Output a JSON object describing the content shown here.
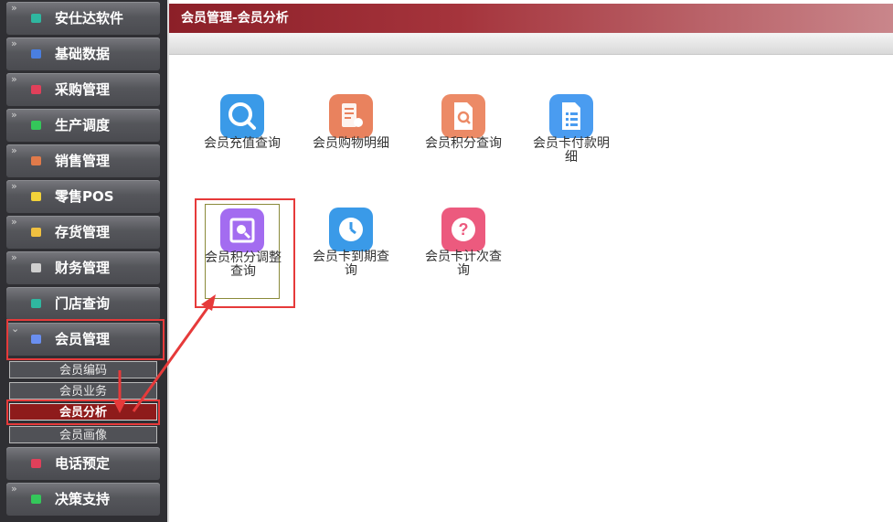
{
  "sidebar": {
    "items": [
      {
        "label": "安仕达软件",
        "icon": "app-icon",
        "color": "#2fb7a0"
      },
      {
        "label": "基础数据",
        "icon": "data-icon",
        "color": "#4a7fe0"
      },
      {
        "label": "采购管理",
        "icon": "purchase-icon",
        "color": "#e0405a"
      },
      {
        "label": "生产调度",
        "icon": "production-icon",
        "color": "#34c75a"
      },
      {
        "label": "销售管理",
        "icon": "sales-icon",
        "color": "#e07a4a"
      },
      {
        "label": "零售POS",
        "icon": "pos-icon",
        "color": "#f2d23a"
      },
      {
        "label": "存货管理",
        "icon": "inventory-icon",
        "color": "#f0c040"
      },
      {
        "label": "财务管理",
        "icon": "finance-icon",
        "color": "#cfcfcf"
      },
      {
        "label": "门店查询",
        "icon": "store-icon",
        "color": "#2fb7a0"
      },
      {
        "label": "会员管理",
        "icon": "member-icon",
        "color": "#6a8ff0"
      },
      {
        "label": "电话预定",
        "icon": "phone-icon",
        "color": "#e0405a"
      },
      {
        "label": "决策支持",
        "icon": "decision-icon",
        "color": "#34c75a"
      }
    ],
    "subitems": [
      {
        "label": "会员编码"
      },
      {
        "label": "会员业务"
      },
      {
        "label": "会员分析"
      },
      {
        "label": "会员画像"
      }
    ]
  },
  "header": {
    "title": "会员管理-会员分析"
  },
  "tiles": [
    {
      "label": "会员充值查询",
      "icon": "search-icon",
      "color": "#3a9ae8"
    },
    {
      "label": "会员购物明细",
      "icon": "receipt-icon",
      "color": "#e9825e"
    },
    {
      "label": "会员积分查询",
      "icon": "doc-search-icon",
      "color": "#ec8a66"
    },
    {
      "label": "会员卡付款明细",
      "icon": "list-doc-icon",
      "color": "#4a9cf0"
    },
    {
      "label": "会员积分调整查询",
      "icon": "frame-search-icon",
      "color": "#a36cf0"
    },
    {
      "label": "会员卡到期查询",
      "icon": "clock-icon",
      "color": "#3a9ae8"
    },
    {
      "label": "会员卡计次查询",
      "icon": "question-icon",
      "color": "#ec5a7e"
    }
  ],
  "colors": {
    "accent": "#8e1b1b",
    "annotation": "#e63a3a"
  }
}
